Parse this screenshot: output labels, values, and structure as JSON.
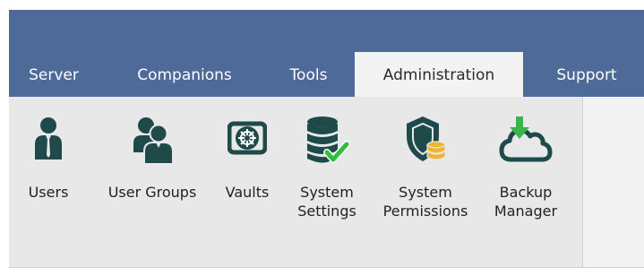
{
  "tabs": [
    {
      "label": "Server"
    },
    {
      "label": "Companions"
    },
    {
      "label": "Tools"
    },
    {
      "label": "Administration",
      "active": true
    },
    {
      "label": "Support"
    }
  ],
  "ribbon": {
    "buttons": [
      {
        "label_line1": "Users",
        "label_line2": "",
        "icon": "user-icon"
      },
      {
        "label_line1": "User Groups",
        "label_line2": "",
        "icon": "user-groups-icon"
      },
      {
        "label_line1": "Vaults",
        "label_line2": "",
        "icon": "vault-icon"
      },
      {
        "label_line1": "System",
        "label_line2": "Settings",
        "icon": "database-check-icon"
      },
      {
        "label_line1": "System",
        "label_line2": "Permissions",
        "icon": "shield-database-icon"
      },
      {
        "label_line1": "Backup",
        "label_line2": "Manager",
        "icon": "cloud-download-icon"
      }
    ]
  },
  "colors": {
    "titlebar": "#4d6a99",
    "icon_dark": "#1f4a4a",
    "check_green": "#2fbf3a",
    "arrow_green": "#39b54a",
    "coin_gold": "#f2b233"
  }
}
